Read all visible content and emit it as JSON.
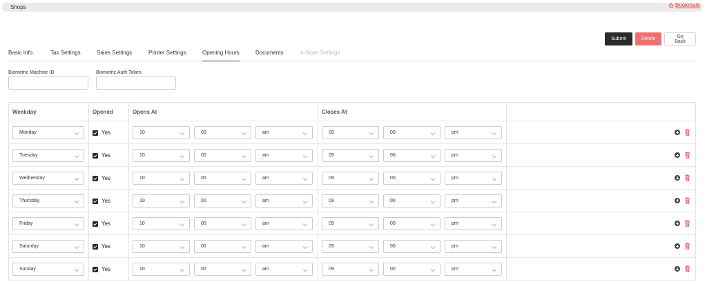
{
  "breadcrumb": {
    "title": "Shops"
  },
  "bookmark": {
    "label": "Bookmark",
    "icon": "star-outline-icon"
  },
  "actions": {
    "submit": "Submit",
    "delete": "Delete",
    "back": "Go Back"
  },
  "tabs": [
    {
      "label": "Basic Info.",
      "state": "normal"
    },
    {
      "label": "Tax Settings",
      "state": "normal"
    },
    {
      "label": "Sales Settings",
      "state": "normal"
    },
    {
      "label": "Printer Settings",
      "state": "normal"
    },
    {
      "label": "Opening Hours",
      "state": "active"
    },
    {
      "label": "Documents",
      "state": "normal"
    },
    {
      "label": "e-Store Settings",
      "state": "disabled"
    }
  ],
  "fields": {
    "biometric_machine_id": {
      "label": "Biometric Machine ID",
      "value": ""
    },
    "biometric_auth_token": {
      "label": "Biometric Auth Token",
      "value": ""
    }
  },
  "table": {
    "headers": {
      "weekday": "Weekday",
      "opened": "Opened",
      "opens_at": "Opens At",
      "closes_at": "Closes At"
    },
    "rows": [
      {
        "weekday": "Monday",
        "opened": "Yes",
        "open_h": "10",
        "open_m": "00",
        "open_p": "am",
        "close_h": "09",
        "close_m": "00",
        "close_p": "pm"
      },
      {
        "weekday": "Tuesday",
        "opened": "Yes",
        "open_h": "10",
        "open_m": "00",
        "open_p": "am",
        "close_h": "09",
        "close_m": "00",
        "close_p": "pm"
      },
      {
        "weekday": "Wednesday",
        "opened": "Yes",
        "open_h": "10",
        "open_m": "00",
        "open_p": "am",
        "close_h": "09",
        "close_m": "00",
        "close_p": "pm"
      },
      {
        "weekday": "Thursday",
        "opened": "Yes",
        "open_h": "10",
        "open_m": "00",
        "open_p": "am",
        "close_h": "09",
        "close_m": "00",
        "close_p": "pm"
      },
      {
        "weekday": "Friday",
        "opened": "Yes",
        "open_h": "10",
        "open_m": "00",
        "open_p": "am",
        "close_h": "09",
        "close_m": "00",
        "close_p": "pm"
      },
      {
        "weekday": "Saturday",
        "opened": "Yes",
        "open_h": "10",
        "open_m": "00",
        "open_p": "am",
        "close_h": "09",
        "close_m": "00",
        "close_p": "pm"
      },
      {
        "weekday": "Sunday",
        "opened": "Yes",
        "open_h": "10",
        "open_m": "00",
        "open_p": "am",
        "close_h": "09",
        "close_m": "00",
        "close_p": "pm"
      }
    ]
  },
  "colors": {
    "accent_dark": "#2b2b2b",
    "danger": "#f07070",
    "bookmark": "#e53935"
  }
}
